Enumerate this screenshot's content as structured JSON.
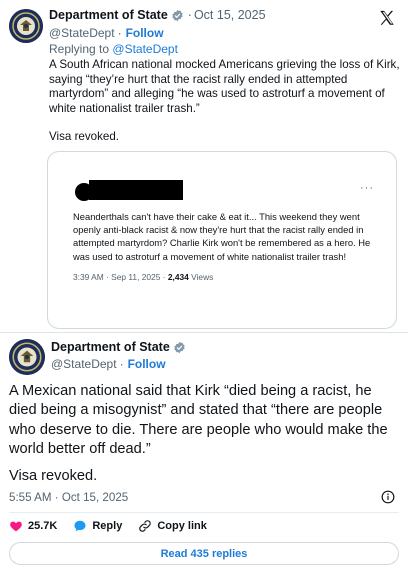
{
  "colors": {
    "link": "#1d7bd8",
    "secondary": "#536471",
    "heart": "#f91880",
    "verified_badge": "#829aab"
  },
  "post1": {
    "author": "Department of State",
    "handle": "@StateDept",
    "follow": "Follow",
    "date": "Oct 15, 2025",
    "separator": "·",
    "replying_prefix": "Replying to",
    "replying_handle": "@StateDept",
    "text": "A South African national mocked Americans grieving the loss of Kirk, saying “they’re hurt that the racist rally ended in attempted martyrdom” and alleging “he was used to astroturf a movement of white nationalist trailer trash.”",
    "revoked": "Visa revoked.",
    "icons": {
      "avatar": "state-dept-seal-icon",
      "verified": "verified-badge-icon",
      "platform": "x-logo-icon"
    },
    "quote": {
      "more": "···",
      "text": "Neanderthals can't have their cake & eat it... This weekend they went openly anti-black racist & now they're hurt that the racist rally ended in attempted martyrdom? Charlie Kirk won't be remembered as a hero. He was used to astroturf a movement of white nationalist trailer trash!",
      "time": "3:39 AM · Sep 11, 2025 ·",
      "views_count": "2,434",
      "views_label": "Views"
    }
  },
  "post2": {
    "author": "Department of State",
    "handle": "@StateDept",
    "follow": "Follow",
    "separator": "·",
    "text": "A Mexican national said that Kirk “died being a racist, he died being a misogynist” and stated that “there are people who deserve to die. There are people who would make the world better off dead.”",
    "revoked": "Visa revoked.",
    "timestamp": "5:55 AM · Oct 15, 2025",
    "likes": "25.7K",
    "reply_label": "Reply",
    "copy_label": "Copy link",
    "read_replies": "Read 435 replies",
    "icons": {
      "info": "info-icon",
      "like": "heart-icon",
      "reply": "reply-bubble-icon",
      "copy": "link-icon"
    }
  }
}
